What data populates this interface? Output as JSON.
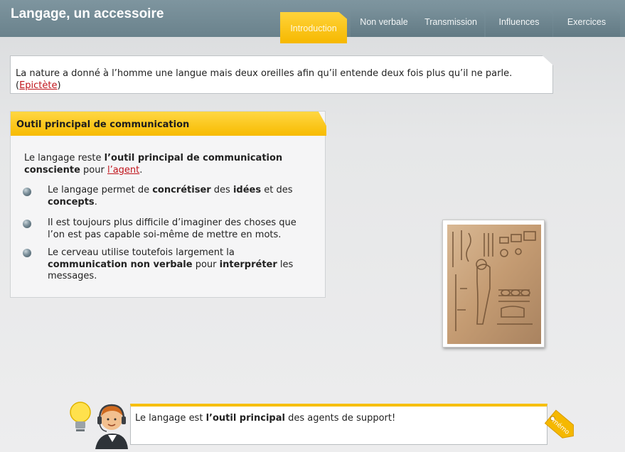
{
  "header": {
    "title": "Langage, un accessoire",
    "tabs": [
      {
        "label": "Introduction",
        "active": true
      },
      {
        "label": "Non verbale",
        "active": false
      },
      {
        "label": "Transmission",
        "active": false
      },
      {
        "label": "Influences",
        "active": false
      },
      {
        "label": "Exercices",
        "active": false
      }
    ]
  },
  "quote": {
    "text": "La nature a donné à l’homme une langue mais deux oreilles afin qu’il entende deux fois plus qu’il ne parle.",
    "open_paren": "(",
    "author": "Epictète",
    "close_paren": ")"
  },
  "panel": {
    "title": "Outil principal de communication",
    "intro": {
      "t1": "Le langage reste ",
      "b1": "l’outil principal de communication consciente",
      "t2": " pour ",
      "link": "l’agent",
      "t3": "."
    },
    "bullets": [
      {
        "t1": "Le langage permet de ",
        "b1": "concrétiser",
        "t2": " des ",
        "b2": "idées",
        "t3": " et des ",
        "b3": "concepts",
        "t4": "."
      },
      {
        "t1": "Il est toujours plus difficile d’imaginer des choses que l’on est pas capable soi-même de mettre en mots."
      },
      {
        "t1": "Le cerveau  utilise toutefois largement la ",
        "b1": "communication non verbale",
        "t2": " pour ",
        "b2": "interpréter",
        "t3": " les messages."
      }
    ]
  },
  "memo": {
    "t1": "Le langage est ",
    "b1": "l’outil principal",
    "t2": " des agents de support!",
    "tag_label": "mémo"
  },
  "colors": {
    "accent_yellow": "#f7bb00",
    "header_slate": "#6a828c",
    "link_red": "#c0141b"
  },
  "icons": [
    "bullet-sphere-icon",
    "lightbulb-icon",
    "support-agent-avatar",
    "memo-tag-icon"
  ]
}
